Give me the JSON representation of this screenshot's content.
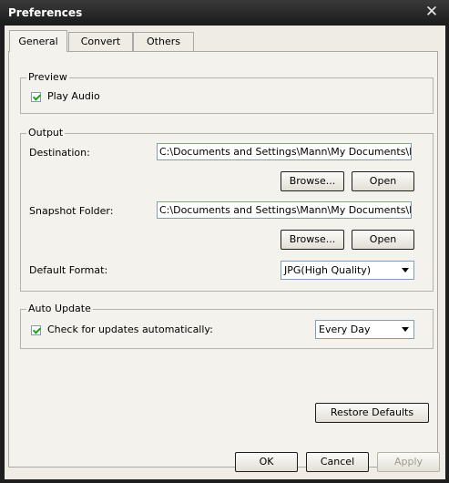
{
  "window": {
    "title": "Preferences",
    "close_glyph": "✕"
  },
  "tabs": [
    {
      "label": "General",
      "active": true
    },
    {
      "label": "Convert",
      "active": false
    },
    {
      "label": "Others",
      "active": false
    }
  ],
  "preview": {
    "title": "Preview",
    "play_audio": {
      "label": "Play Audio",
      "checked": true
    }
  },
  "output": {
    "title": "Output",
    "destination_label": "Destination:",
    "destination_value": "C:\\Documents and Settings\\Mann\\My Documents\\My Videos",
    "snapshot_label": "Snapshot Folder:",
    "snapshot_value": "C:\\Documents and Settings\\Mann\\My Documents\\My Pictures",
    "browse_label": "Browse...",
    "open_label": "Open",
    "format_label": "Default Format:",
    "format_value": "JPG(High Quality)"
  },
  "auto_update": {
    "title": "Auto Update",
    "check_label": "Check for updates automatically:",
    "checked": true,
    "frequency": "Every Day"
  },
  "buttons": {
    "restore_defaults": "Restore Defaults",
    "ok": "OK",
    "cancel": "Cancel",
    "apply": "Apply"
  },
  "icons": {
    "checkbox": "checkmark-icon",
    "dropdown": "chevron-down-icon",
    "close": "close-icon"
  }
}
